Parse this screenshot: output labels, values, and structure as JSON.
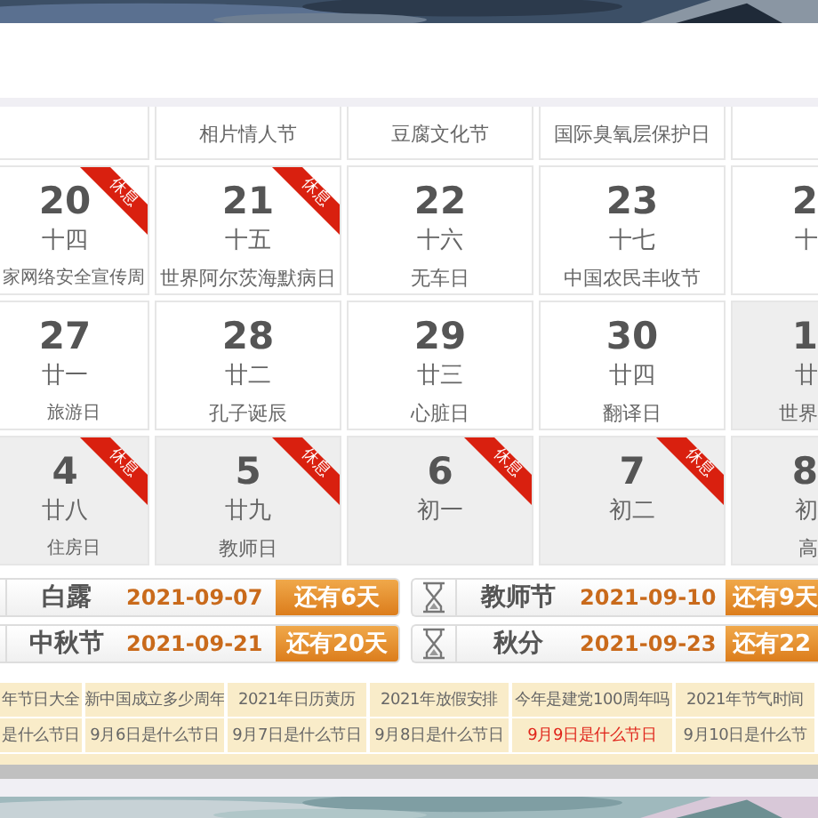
{
  "calendar": {
    "weeks": [
      [
        {
          "other_month": false
        },
        {
          "festival": "相片情人节",
          "other_month": false
        },
        {
          "festival": "豆腐文化节",
          "other_month": false
        },
        {
          "festival": "国际臭氧层保护日",
          "other_month": false
        },
        {
          "other_month": false
        }
      ],
      [
        {
          "day": "20",
          "lunar": "十四",
          "festival": "家网络安全宣传周",
          "badge": "休息",
          "other_month": false
        },
        {
          "day": "21",
          "lunar": "十五",
          "festival": "世界阿尔茨海默病日",
          "badge": "休息",
          "other_month": false
        },
        {
          "day": "22",
          "lunar": "十六",
          "festival": "无车日",
          "other_month": false
        },
        {
          "day": "23",
          "lunar": "十七",
          "festival": "中国农民丰收节",
          "other_month": false
        },
        {
          "day": "2",
          "lunar": "十",
          "other_month": false
        }
      ],
      [
        {
          "day": "27",
          "lunar": "廿一",
          "festival": "旅游日",
          "other_month": false
        },
        {
          "day": "28",
          "lunar": "廿二",
          "festival": "孔子诞辰",
          "other_month": false
        },
        {
          "day": "29",
          "lunar": "廿三",
          "festival": "心脏日",
          "other_month": false
        },
        {
          "day": "30",
          "lunar": "廿四",
          "festival": "翻译日",
          "other_month": false
        },
        {
          "day": "1",
          "lunar": "廿",
          "festival": "世界",
          "other_month": true
        }
      ],
      [
        {
          "day": "4",
          "lunar": "廿八",
          "festival": "住房日",
          "badge": "休息",
          "other_month": true
        },
        {
          "day": "5",
          "lunar": "廿九",
          "festival": "教师日",
          "badge": "休息",
          "other_month": true
        },
        {
          "day": "6",
          "lunar": "初一",
          "badge": "休息",
          "other_month": true
        },
        {
          "day": "7",
          "lunar": "初二",
          "badge": "休息",
          "other_month": true
        },
        {
          "day": "8",
          "lunar": "初",
          "festival": "高",
          "other_month": true
        }
      ]
    ]
  },
  "countdowns": [
    {
      "name": "白露",
      "date": "2021-09-07",
      "remaining": "还有6天",
      "icon": false
    },
    {
      "name": "教师节",
      "date": "2021-09-10",
      "remaining": "还有9天",
      "icon": true
    },
    {
      "name": "中秋节",
      "date": "2021-09-21",
      "remaining": "还有20天",
      "icon": false
    },
    {
      "name": "秋分",
      "date": "2021-09-23",
      "remaining": "还有22",
      "icon": true
    }
  ],
  "links": [
    [
      {
        "text": "年节日大全",
        "highlighted": false
      },
      {
        "text": "新中国成立多少周年",
        "highlighted": false
      },
      {
        "text": "2021年日历黄历",
        "highlighted": false
      },
      {
        "text": "2021年放假安排",
        "highlighted": false
      },
      {
        "text": "今年是建党100周年吗",
        "highlighted": false
      },
      {
        "text": "2021年节气时间",
        "highlighted": false
      }
    ],
    [
      {
        "text": "是什么节日",
        "highlighted": false
      },
      {
        "text": "9月6日是什么节日",
        "highlighted": false
      },
      {
        "text": "9月7日是什么节日",
        "highlighted": false
      },
      {
        "text": "9月8日是什么节日",
        "highlighted": false
      },
      {
        "text": "9月9日是什么节日",
        "highlighted": true
      },
      {
        "text": "9月10日是什么节",
        "highlighted": false
      }
    ]
  ]
}
